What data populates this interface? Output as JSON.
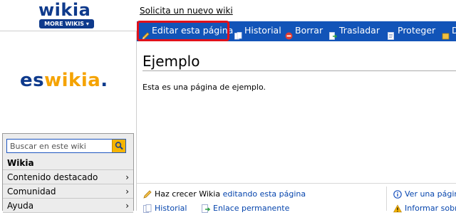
{
  "header": {
    "logo_text": "wikia",
    "more_wikis_label": "MORE WIKIS ▾",
    "request_link": "Solicita un nuevo wiki"
  },
  "actions": {
    "edit": "Editar esta página",
    "history": "Historial",
    "delete": "Borrar",
    "move": "Trasladar",
    "protect": "Proteger",
    "more_partial": "D"
  },
  "sidebar": {
    "wiki_logo": {
      "es": "es",
      "wikia": "wikia",
      "dot": "."
    },
    "search_placeholder": "Buscar en este wiki",
    "items": [
      {
        "label": "Wikia",
        "has_chevron": false
      },
      {
        "label": "Contenido destacado",
        "has_chevron": true
      },
      {
        "label": "Comunidad",
        "has_chevron": true
      },
      {
        "label": "Ayuda",
        "has_chevron": true
      }
    ],
    "chevron": "›"
  },
  "main": {
    "title": "Ejemplo",
    "body": "Esta es una página de ejemplo."
  },
  "footer": {
    "grow_prefix": "Haz crecer Wikia",
    "grow_link": "editando esta página",
    "history": "Historial",
    "permalink": "Enlace permanente",
    "view_partial": "Ver una página",
    "report_partial": "Informar sobre"
  },
  "colors": {
    "action_bar": "#1254b8",
    "highlight": "#e0111b",
    "brand_blue": "#0e3a8c",
    "brand_orange": "#f5a300",
    "link": "#0645ad"
  },
  "icons": {
    "edit": "pencil-icon",
    "history": "document-pages-icon",
    "delete": "delete-circle-icon",
    "move": "move-arrow-icon",
    "protect": "lock-page-icon",
    "search": "search-magnifier-icon"
  }
}
